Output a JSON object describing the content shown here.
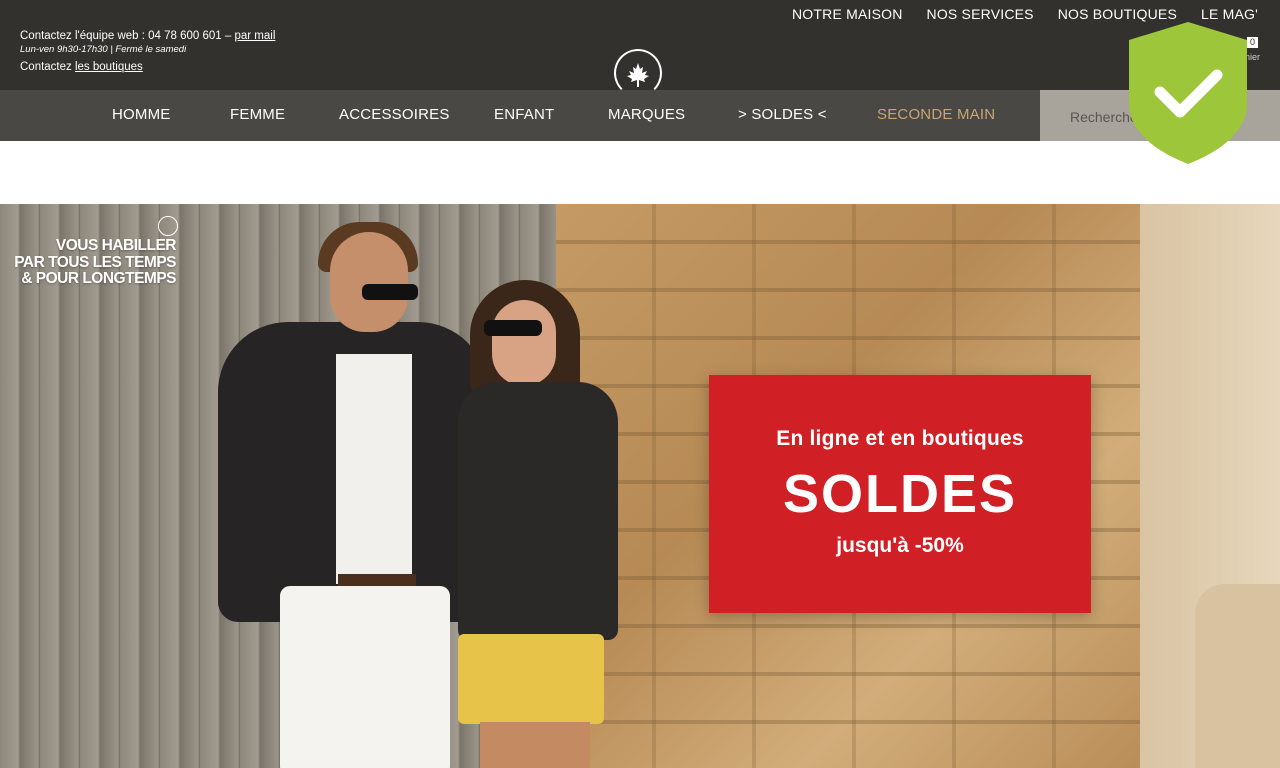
{
  "header": {
    "top_links": [
      "NOTRE MAISON",
      "NOS SERVICES",
      "NOS BOUTIQUES",
      "LE MAG'"
    ],
    "contact_prefix": "Contactez l'équipe web : 04 78 600 601 – ",
    "contact_mail_link": "par mail",
    "hours": "Lun-ven 9h30-17h30 | Fermé le samedi",
    "contact_shops_prefix": "Contactez ",
    "contact_shops_link": "les boutiques",
    "account_label": "Mon compte    Panier",
    "cart_count": "0",
    "logo_icon": "maple-leaf-icon"
  },
  "nav": {
    "items": [
      {
        "label": "HOMME"
      },
      {
        "label": "FEMME"
      },
      {
        "label": "ACCESSOIRES"
      },
      {
        "label": "ENFANT"
      },
      {
        "label": "MARQUES"
      },
      {
        "label": "> SOLDES <"
      },
      {
        "label": "SECONDE MAIN"
      }
    ],
    "accent_color": "#c9a475",
    "search_placeholder": "Recherche"
  },
  "hero": {
    "tagline": [
      "VOUS HABILLER",
      "PAR TOUS LES TEMPS",
      "& POUR LONGTEMPS"
    ],
    "promo": {
      "line1": "En ligne et en boutiques",
      "line2": "SOLDES",
      "line3": "jusqu'à -50%",
      "color": "#d11f26"
    }
  },
  "badge": {
    "icon": "security-shield-check-icon",
    "color": "#9dc63a"
  }
}
